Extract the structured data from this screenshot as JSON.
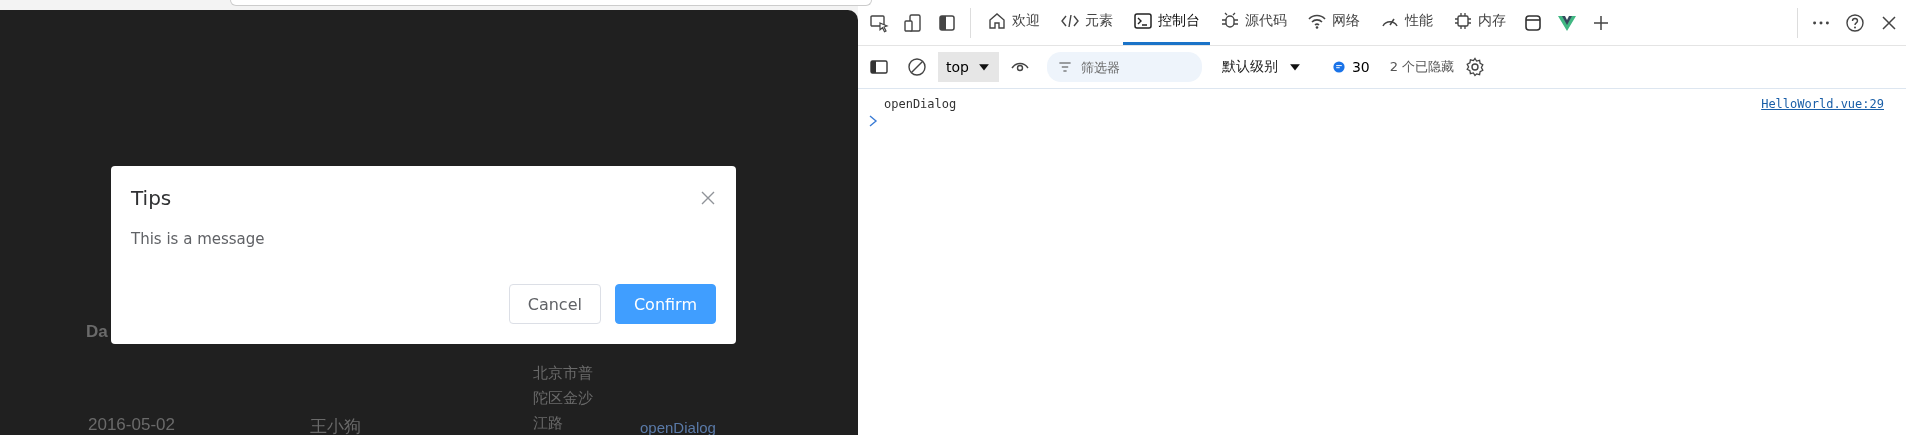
{
  "page": {
    "table_header": "Da",
    "row": [
      "2016-05-02",
      "王小狗",
      "北京市普陀区金沙江路"
    ],
    "row_link": "openDialog"
  },
  "dialog": {
    "title": "Tips",
    "message": "This is a message",
    "buttons": [
      {
        "label": "Cancel",
        "kind": "default"
      },
      {
        "label": "Confirm",
        "kind": "primary"
      }
    ]
  },
  "devtools": {
    "tabs": [
      {
        "label": "欢迎",
        "selected": false
      },
      {
        "label": "元素",
        "selected": false
      },
      {
        "label": "控制台",
        "selected": true
      },
      {
        "label": "源代码",
        "selected": false
      },
      {
        "label": "网络",
        "selected": false
      },
      {
        "label": "性能",
        "selected": false
      },
      {
        "label": "内存",
        "selected": false
      }
    ],
    "context": "top",
    "filter": {
      "placeholder": "筛选器"
    },
    "level_menu": "默认级别",
    "message_count": "30",
    "hidden": "2 个已隐藏",
    "console": [
      {
        "text": "openDialog",
        "source": "HelloWorld.vue:29"
      }
    ]
  }
}
